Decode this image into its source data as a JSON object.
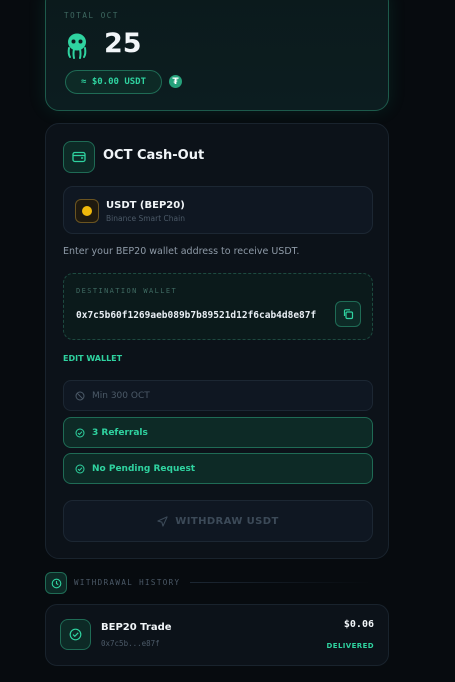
{
  "total": {
    "label": "TOTAL OCT",
    "value": "25",
    "usdt_equivalent": "≈ $0.00 USDT",
    "icon": "octopus-icon",
    "currency_icon": "tether-icon"
  },
  "cashout": {
    "title": "OCT Cash-Out",
    "header_icon": "wallet-icon",
    "coin": {
      "name": "USDT (BEP20)",
      "chain": "Binance Smart Chain",
      "icon": "bnb-coin-icon"
    },
    "instructions": "Enter your BEP20 wallet address to receive USDT.",
    "wallet": {
      "label": "DESTINATION WALLET",
      "address": "0x7c5b60f1269aeb089b7b89521d12f6cab4d8e87f",
      "copy_icon": "copy-icon"
    },
    "edit_wallet_label": "EDIT WALLET",
    "requirements": {
      "minimum": "Min 300 OCT",
      "referrals": "3 Referrals",
      "pending": "No Pending Request"
    },
    "withdraw_label": "WITHDRAW USDT"
  },
  "history": {
    "title": "WITHDRAWAL HISTORY",
    "items": [
      {
        "name": "BEP20 Trade",
        "address": "0x7c5b...e87f",
        "amount": "$0.06",
        "status": "DELIVERED"
      }
    ]
  },
  "colors": {
    "accent": "#2fd3a0",
    "background": "#070b0f",
    "card": "#0c1219",
    "tether": "#26a17b",
    "bnb": "#f0b90b"
  }
}
